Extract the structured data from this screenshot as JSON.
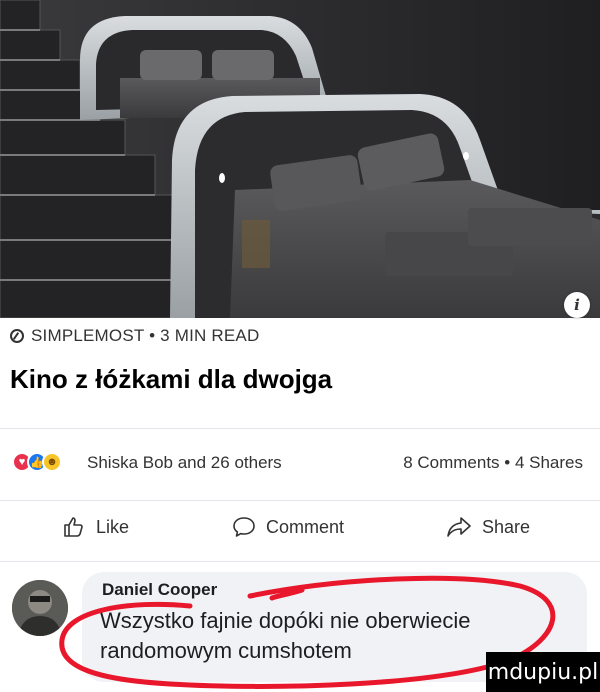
{
  "preview": {
    "source_icon": "compass-icon",
    "source": "SIMPLEMOST • 3 MIN READ",
    "headline": "Kino z łóżkami dla dwojga",
    "info_icon_glyph": "i"
  },
  "reactions": {
    "icons": [
      "love-reaction-icon",
      "like-reaction-icon",
      "haha-reaction-icon"
    ],
    "text": "Shiska Bob and 26 others",
    "counts": "8 Comments • 4 Shares"
  },
  "actions": {
    "like": "Like",
    "comment": "Comment",
    "share": "Share"
  },
  "comment": {
    "author": "Daniel Cooper",
    "text": "Wszystko fajnie dopóki nie oberwiecie randomowym cumshotem"
  },
  "watermark": "mdupiu.pl",
  "colors": {
    "scribble": "#e8172b",
    "bubble": "#f0f2f5",
    "like_blue": "#1877f2"
  }
}
